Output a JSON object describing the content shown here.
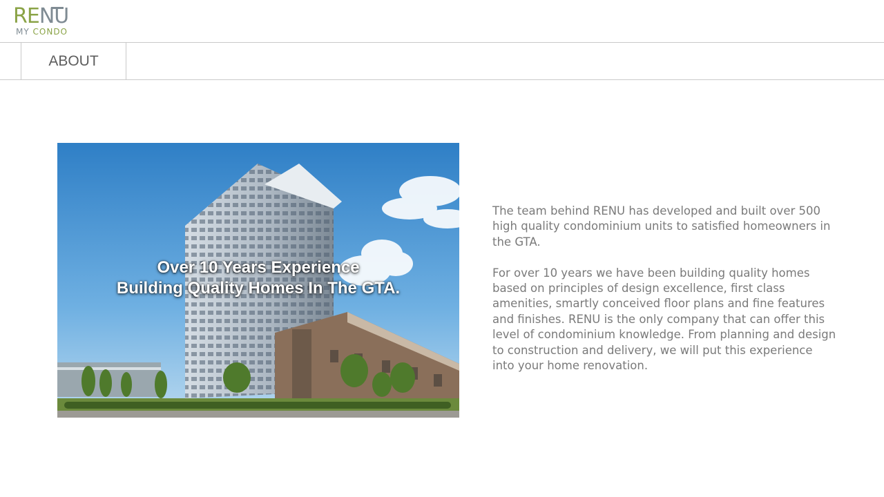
{
  "brand": {
    "main_left": "RE",
    "main_right": "NU",
    "sub_left": "MY",
    "sub_right": "CONDO",
    "colors": {
      "green": "#8aa346",
      "gray": "#7f8b93"
    }
  },
  "nav": {
    "tabs": [
      {
        "label": "ABOUT",
        "active": true
      }
    ]
  },
  "hero": {
    "image_description": "high-rise condominium tower with townhomes under blue sky",
    "headline_line1": "Over 10 Years Experience",
    "headline_line2": "Building Quality Homes In The GTA."
  },
  "about": {
    "paragraph1": "The team behind RENU has developed and built over 500 high quality condominium units to satisfied homeowners in the GTA.",
    "paragraph2": "For over 10 years we have been building quality homes based on principles of design excellence, first class amenities, smartly conceived floor plans and fine features and finishes. RENU is the only company that can offer this level of condominium knowledge. From planning and design to construction and delivery, we will put this experience into your home renovation."
  }
}
